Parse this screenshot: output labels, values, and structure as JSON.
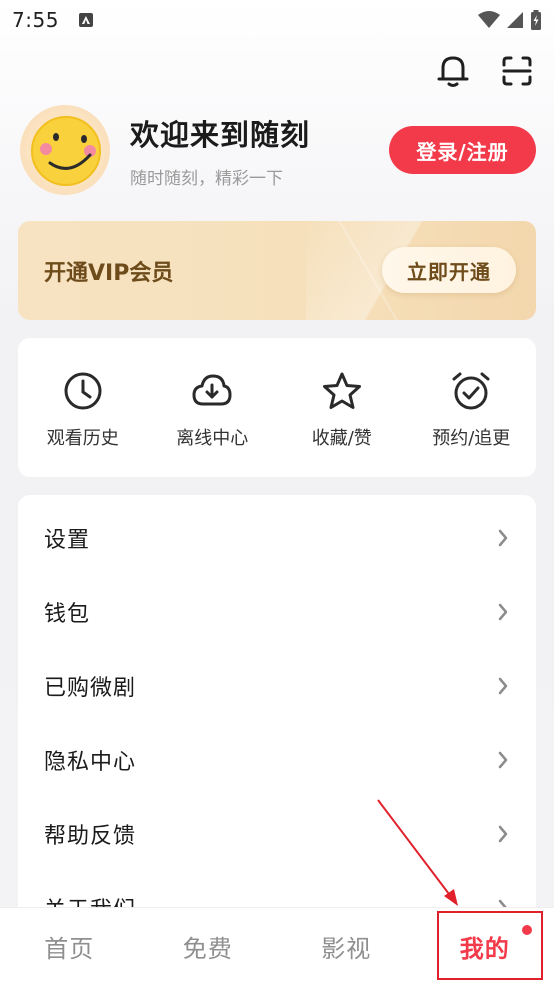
{
  "status_bar": {
    "time": "7:55"
  },
  "profile": {
    "welcome": "欢迎来到随刻",
    "subtitle": "随时随刻，精彩一下",
    "login_label": "登录/注册"
  },
  "vip": {
    "title": "开通VIP会员",
    "button_label": "立即开通"
  },
  "quick": {
    "items": [
      {
        "label": "观看历史",
        "icon": "clock-icon"
      },
      {
        "label": "离线中心",
        "icon": "download-cloud-icon"
      },
      {
        "label": "收藏/赞",
        "icon": "star-icon"
      },
      {
        "label": "预约/追更",
        "icon": "alarm-check-icon"
      }
    ]
  },
  "menu": {
    "items": [
      {
        "label": "设置"
      },
      {
        "label": "钱包"
      },
      {
        "label": "已购微剧"
      },
      {
        "label": "隐私中心"
      },
      {
        "label": "帮助反馈"
      },
      {
        "label": "关于我们"
      }
    ]
  },
  "nav": {
    "items": [
      {
        "label": "首页"
      },
      {
        "label": "免费"
      },
      {
        "label": "影视"
      },
      {
        "label": "我的"
      }
    ],
    "active_index": 3
  },
  "colors": {
    "accent": "#f33a4a",
    "vip_text": "#6e4b1a",
    "vip_bg": "#f6e0bb"
  }
}
